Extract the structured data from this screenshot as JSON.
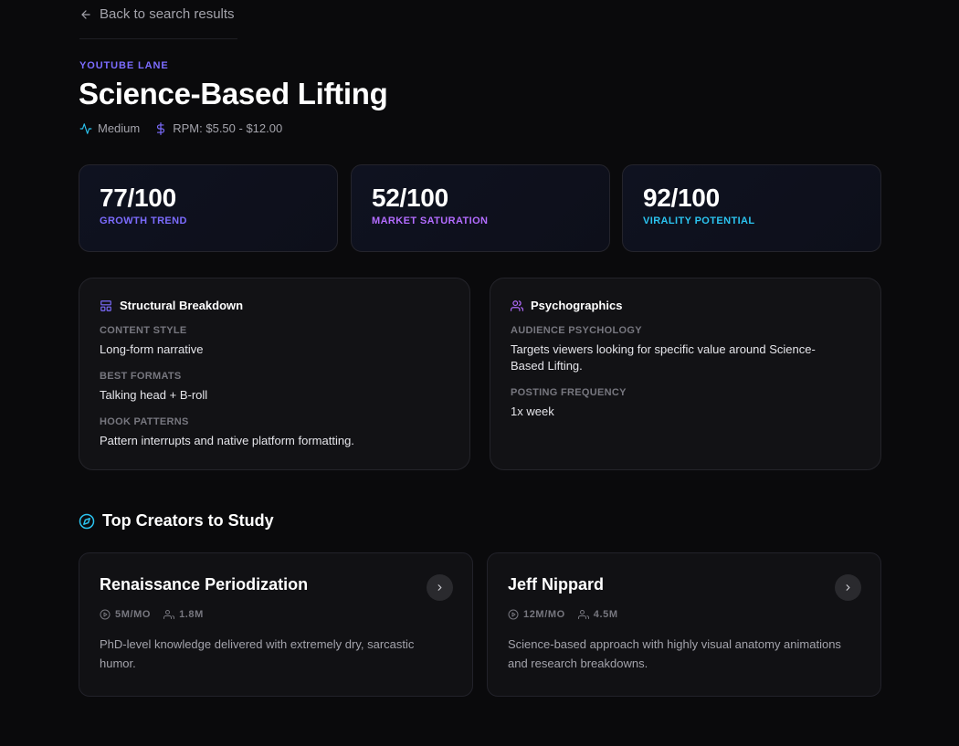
{
  "nav": {
    "back_label": "Back to search results"
  },
  "header": {
    "eyebrow": "YOUTUBE LANE",
    "title": "Science-Based Lifting",
    "difficulty": "Medium",
    "rpm": "RPM: $5.50 - $12.00"
  },
  "stats": [
    {
      "value": "77/100",
      "label": "GROWTH TREND",
      "score": 77,
      "color": "#7c6cff"
    },
    {
      "value": "52/100",
      "label": "MARKET SATURATION",
      "score": 52,
      "color": "#b36cff"
    },
    {
      "value": "92/100",
      "label": "VIRALITY POTENTIAL",
      "score": 92,
      "color": "#2bc4f0"
    }
  ],
  "structural": {
    "title": "Structural Breakdown",
    "fields": [
      {
        "label": "CONTENT STYLE",
        "value": "Long-form narrative"
      },
      {
        "label": "BEST FORMATS",
        "value": "Talking head + B-roll"
      },
      {
        "label": "HOOK PATTERNS",
        "value": "Pattern interrupts and native platform formatting."
      }
    ]
  },
  "psychographics": {
    "title": "Psychographics",
    "fields": [
      {
        "label": "AUDIENCE PSYCHOLOGY",
        "value": "Targets viewers looking for specific value around Science-Based Lifting."
      },
      {
        "label": "POSTING FREQUENCY",
        "value": "1x week"
      }
    ]
  },
  "creators_section": {
    "title": "Top Creators to Study"
  },
  "creators": [
    {
      "name": "Renaissance Periodization",
      "views": "5M/MO",
      "subscribers": "1.8M",
      "description": "PhD-level knowledge delivered with extremely dry, sarcastic humor."
    },
    {
      "name": "Jeff Nippard",
      "views": "12M/MO",
      "subscribers": "4.5M",
      "description": "Science-based approach with highly visual anatomy animations and research breakdowns."
    }
  ],
  "colors": {
    "accent": "#7c6cff",
    "cyan": "#2bc4f0",
    "background": "#0a0a0c"
  }
}
